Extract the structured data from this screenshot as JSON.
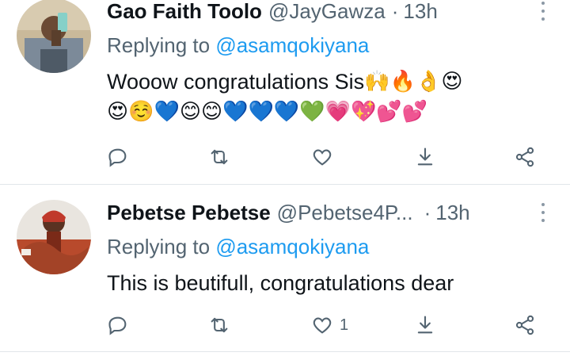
{
  "tweets": [
    {
      "name": "Gao Faith Toolo",
      "handle": "@JayGawza",
      "separator": "·",
      "time": "13h",
      "replying_prefix": "Replying to",
      "replying_to": "@asamqokiyana",
      "text": "Wooow congratulations Sis",
      "emojis_line1": [
        "🙌",
        "🔥",
        "👌",
        "😍"
      ],
      "emojis_line2": [
        "😍",
        "☺️",
        "💙",
        "😊",
        "😊",
        "💙",
        "💙",
        "💙",
        "💚",
        "💗",
        "💖",
        "💕",
        "💕"
      ],
      "like_count": "",
      "avatar_icon": "person-phone-selfie-avatar"
    },
    {
      "name": "Pebetse Pebetse",
      "handle": "@Pebetse4P...",
      "separator": "·",
      "time": "13h",
      "replying_prefix": "Replying to",
      "replying_to": "@asamqokiyana",
      "text": "This is beutifull, congratulations dear",
      "like_count": "1",
      "avatar_icon": "woman-red-headwrap-avatar"
    }
  ],
  "icons": {
    "reply": "reply-icon",
    "retweet": "retweet-icon",
    "like": "heart-icon",
    "download": "download-icon",
    "share": "share-icon",
    "more": "more-icon"
  },
  "colors": {
    "text": "#0f1419",
    "secondary": "#536471",
    "link": "#1d9bf0",
    "divider": "#e1e6ea"
  }
}
